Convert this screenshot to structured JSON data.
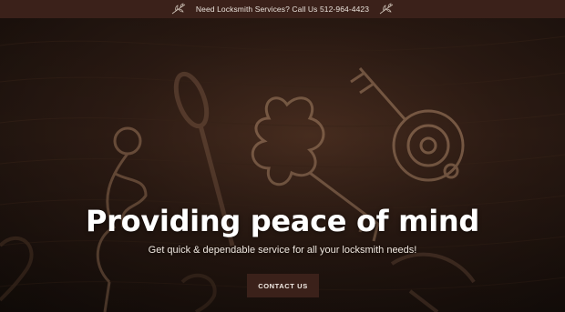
{
  "announcement": {
    "text": "Need Locksmith Services? Call Us 512-964-4423",
    "left_icon": "sprig-icon",
    "right_icon": "sprig-icon"
  },
  "hero": {
    "headline": "Providing peace of mind",
    "subheadline": "Get quick & dependable service for all your locksmith needs!",
    "cta_label": "CONTACT US"
  },
  "colors": {
    "bar_background": "#3b211a",
    "button_background": "#3b211a",
    "text_light": "#ffffff"
  }
}
